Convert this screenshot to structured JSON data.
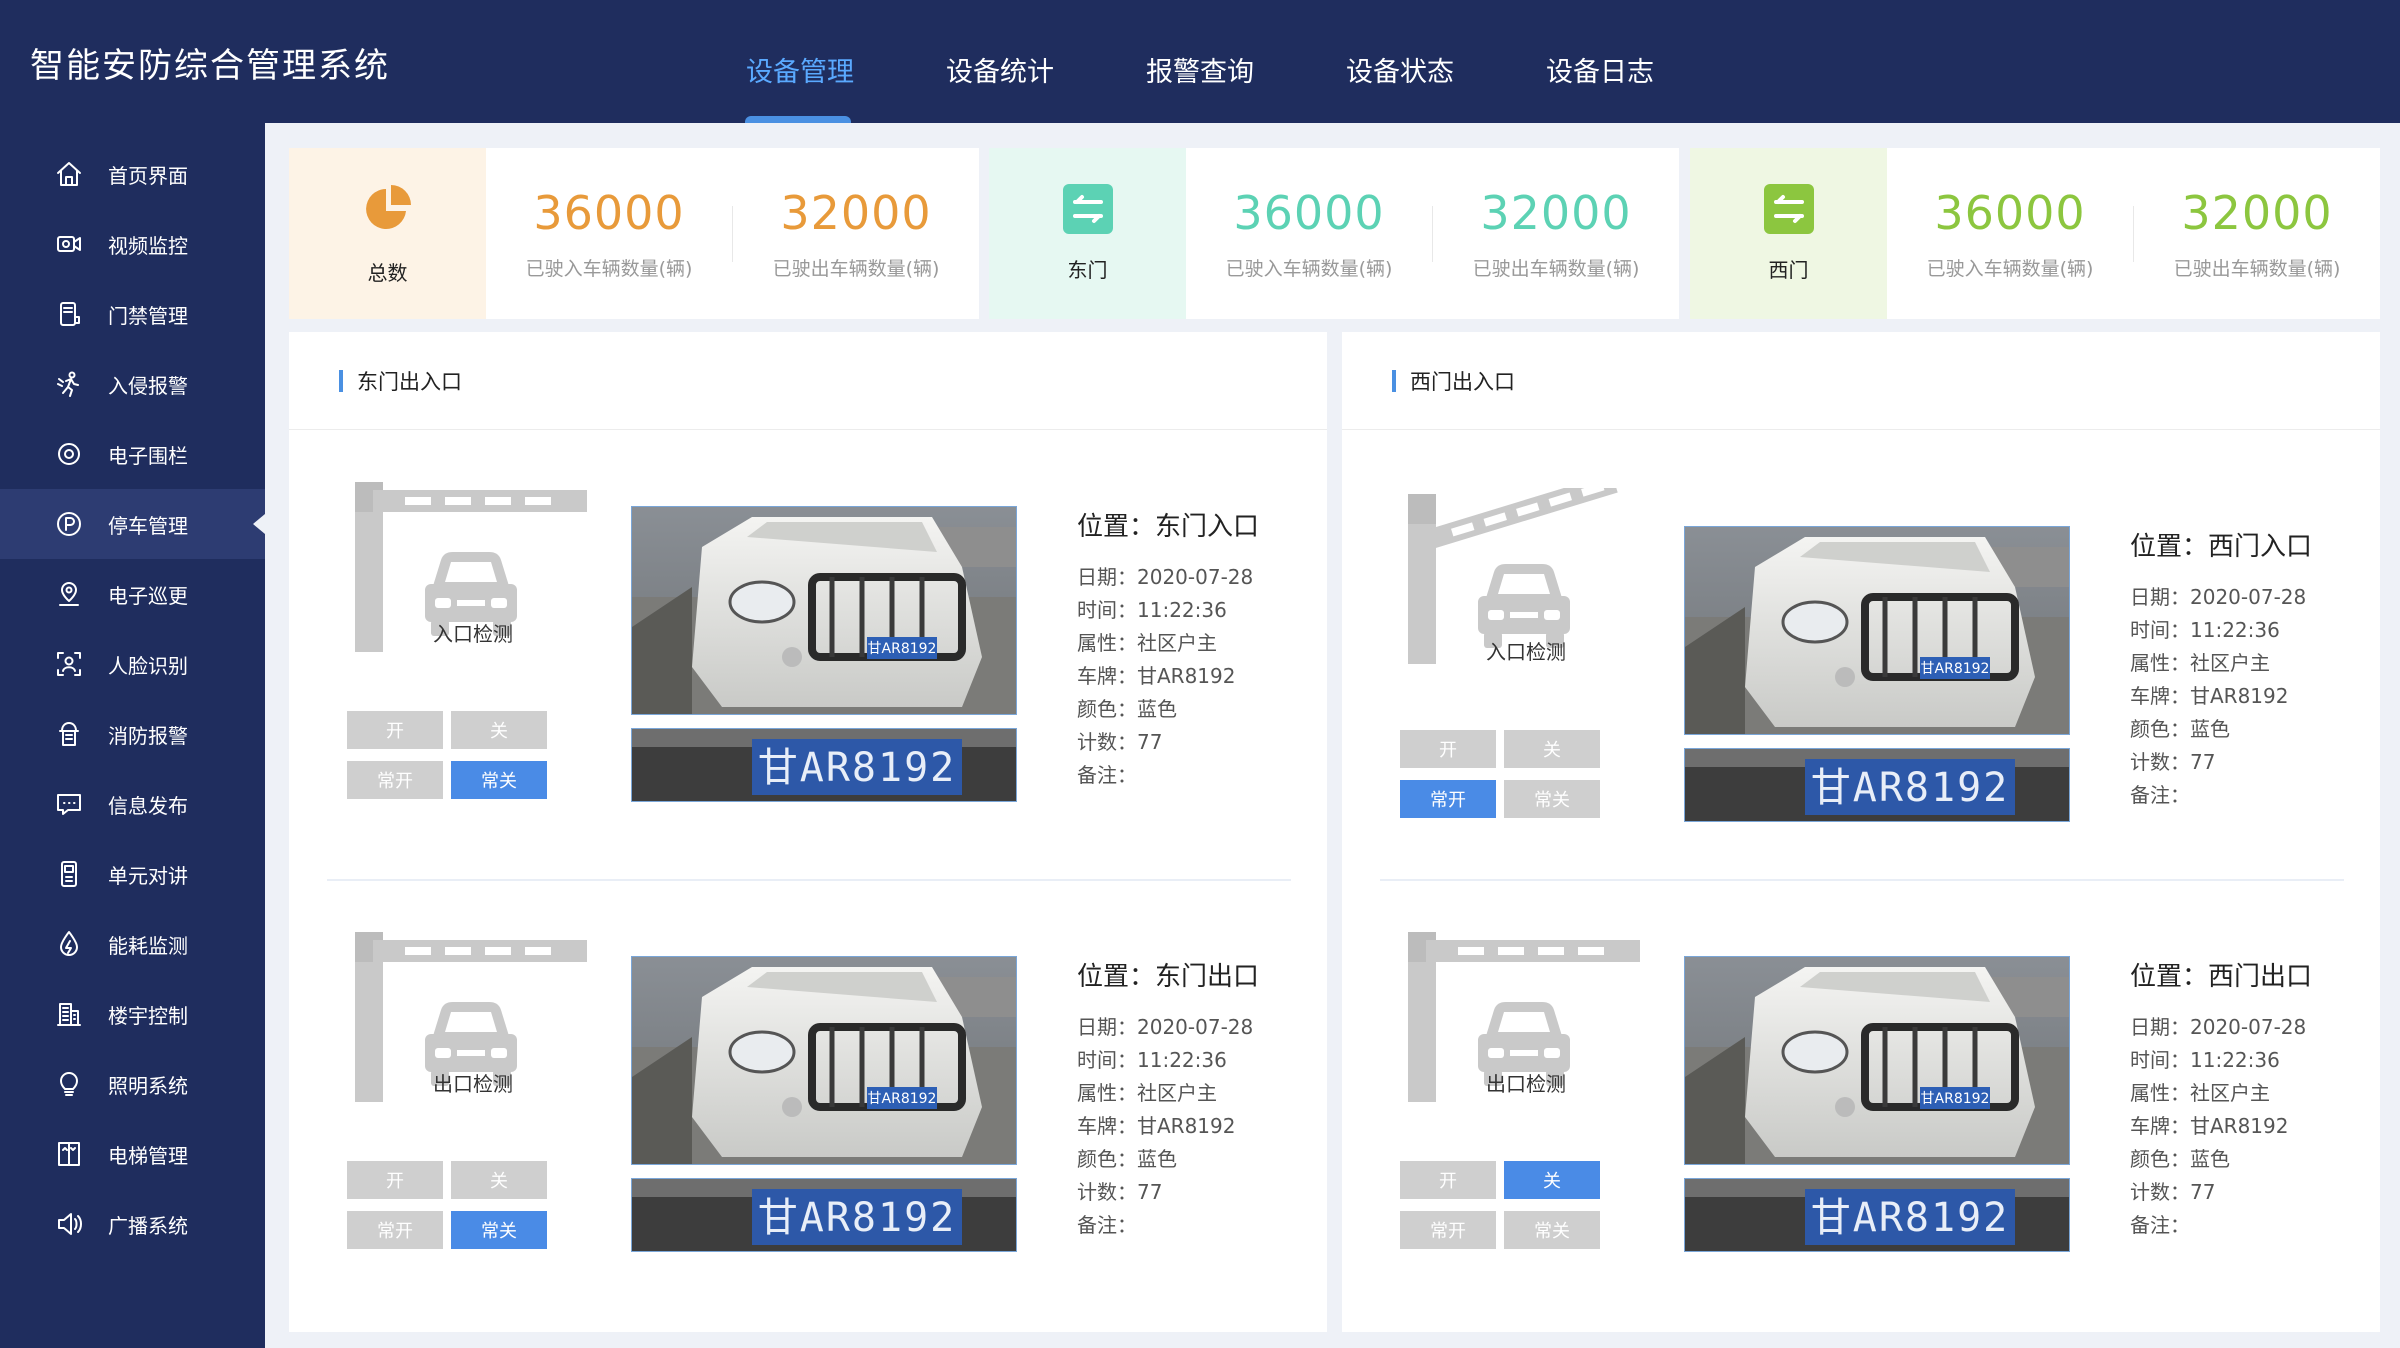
{
  "app": {
    "title": "智能安防综合管理系统"
  },
  "top_nav": [
    {
      "label": "设备管理",
      "active": true
    },
    {
      "label": "设备统计",
      "active": false
    },
    {
      "label": "报警查询",
      "active": false
    },
    {
      "label": "设备状态",
      "active": false
    },
    {
      "label": "设备日志",
      "active": false
    }
  ],
  "sidebar": {
    "items": [
      {
        "label": "首页界面",
        "icon": "home-icon"
      },
      {
        "label": "视频监控",
        "icon": "video-camera-icon"
      },
      {
        "label": "门禁管理",
        "icon": "access-control-icon"
      },
      {
        "label": "入侵报警",
        "icon": "intrusion-runner-icon"
      },
      {
        "label": "电子围栏",
        "icon": "fence-target-icon"
      },
      {
        "label": "停车管理",
        "icon": "parking-icon",
        "active": true
      },
      {
        "label": "电子巡更",
        "icon": "patrol-location-icon"
      },
      {
        "label": "人脸识别",
        "icon": "face-scan-icon"
      },
      {
        "label": "消防报警",
        "icon": "fire-alarm-icon"
      },
      {
        "label": "信息发布",
        "icon": "message-icon"
      },
      {
        "label": "单元对讲",
        "icon": "intercom-icon"
      },
      {
        "label": "能耗监测",
        "icon": "energy-drop-icon"
      },
      {
        "label": "楼宇控制",
        "icon": "building-icon"
      },
      {
        "label": "照明系统",
        "icon": "lightbulb-icon"
      },
      {
        "label": "电梯管理",
        "icon": "elevator-icon"
      },
      {
        "label": "广播系统",
        "icon": "speaker-icon"
      }
    ]
  },
  "stats": [
    {
      "label": "总数",
      "icon": "pie-chart-icon",
      "color": "#e89a3a",
      "bg": "#fdf3e6",
      "in_value": "36000",
      "in_caption": "已驶入车辆数量(辆)",
      "out_value": "32000",
      "out_caption": "已驶出车辆数量(辆)"
    },
    {
      "label": "东门",
      "icon": "swap-arrows-icon",
      "color": "#5cd2b4",
      "bg": "#e6f8f2",
      "in_value": "36000",
      "in_caption": "已驶入车辆数量(辆)",
      "out_value": "32000",
      "out_caption": "已驶出车辆数量(辆)"
    },
    {
      "label": "西门",
      "icon": "swap-arrows-icon",
      "color": "#8cc63f",
      "bg": "#eff7e3",
      "in_value": "36000",
      "in_caption": "已驶入车辆数量(辆)",
      "out_value": "32000",
      "out_caption": "已驶出车辆数量(辆)"
    }
  ],
  "panels": [
    {
      "title": "东门出入口",
      "lanes": [
        {
          "gate_label": "入口检测",
          "gate_raised": false,
          "buttons": {
            "open": "开",
            "close": "关",
            "always_open": "常开",
            "always_close": "常关"
          },
          "active_button": "always_close",
          "position": "位置：东门入口",
          "date_label": "日期：",
          "date": "2020-07-28",
          "time_label": "时间：",
          "time": "11:22:36",
          "attr_label": "属性：",
          "attr": "社区户主",
          "plate_label": "车牌：",
          "plate": "甘AR8192",
          "color_label": "颜色：",
          "color": "蓝色",
          "count_label": "计数：",
          "count": "77",
          "note_label": "备注：",
          "note": ""
        },
        {
          "gate_label": "出口检测",
          "gate_raised": false,
          "buttons": {
            "open": "开",
            "close": "关",
            "always_open": "常开",
            "always_close": "常关"
          },
          "active_button": "always_close",
          "position": "位置：东门出口",
          "date_label": "日期：",
          "date": "2020-07-28",
          "time_label": "时间：",
          "time": "11:22:36",
          "attr_label": "属性：",
          "attr": "社区户主",
          "plate_label": "车牌：",
          "plate": "甘AR8192",
          "color_label": "颜色：",
          "color": "蓝色",
          "count_label": "计数：",
          "count": "77",
          "note_label": "备注：",
          "note": ""
        }
      ]
    },
    {
      "title": "西门出入口",
      "lanes": [
        {
          "gate_label": "入口检测",
          "gate_raised": true,
          "buttons": {
            "open": "开",
            "close": "关",
            "always_open": "常开",
            "always_close": "常关"
          },
          "active_button": "always_open",
          "position": "位置：西门入口",
          "date_label": "日期：",
          "date": "2020-07-28",
          "time_label": "时间：",
          "time": "11:22:36",
          "attr_label": "属性：",
          "attr": "社区户主",
          "plate_label": "车牌：",
          "plate": "甘AR8192",
          "color_label": "颜色：",
          "color": "蓝色",
          "count_label": "计数：",
          "count": "77",
          "note_label": "备注：",
          "note": ""
        },
        {
          "gate_label": "出口检测",
          "gate_raised": false,
          "buttons": {
            "open": "开",
            "close": "关",
            "always_open": "常开",
            "always_close": "常关"
          },
          "active_button": "close",
          "position": "位置：西门出口",
          "date_label": "日期：",
          "date": "2020-07-28",
          "time_label": "时间：",
          "time": "11:22:36",
          "attr_label": "属性：",
          "attr": "社区户主",
          "plate_label": "车牌：",
          "plate": "甘AR8192",
          "color_label": "颜色：",
          "color": "蓝色",
          "count_label": "计数：",
          "count": "77",
          "note_label": "备注：",
          "note": ""
        }
      ]
    }
  ],
  "theme": {
    "nav_bg": "#1f2d5e",
    "accent": "#4a8be6",
    "active_tab": "#5aa9ff"
  }
}
